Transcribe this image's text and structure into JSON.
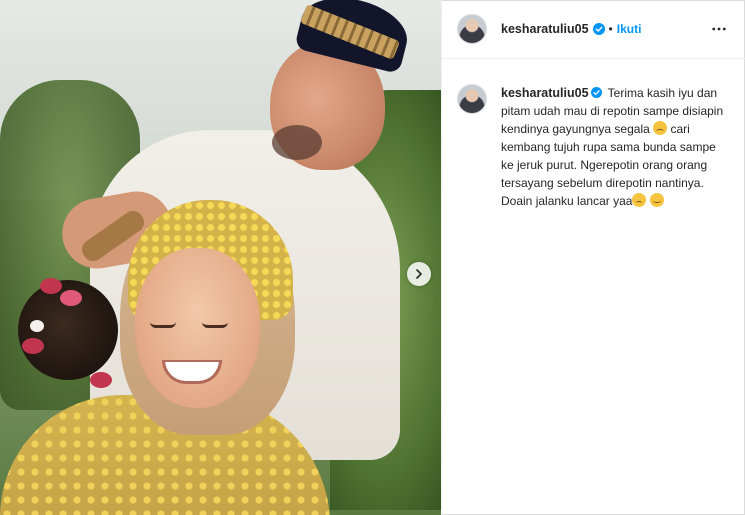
{
  "post": {
    "username": "kesharatuliu05",
    "separator": "•",
    "follow_label": "Ikuti",
    "caption_part1": "Terima kasih iyu dan pitam udah mau di repotin sampe disiapin kendinya gayungnya segala",
    "caption_part2": "cari kembang tujuh rupa sama bunda sampe ke jeruk purut. Ngerepotin orang orang tersayang sebelum direpotin nantinya. Doain jalanku lancar yaa",
    "emoji_1": "crying-face",
    "emoji_2": "sad-face",
    "emoji_3": "hugging-face"
  },
  "colors": {
    "follow": "#0095f6",
    "verified": "#0095f6",
    "text": "#262626",
    "border": "#dbdbdb"
  },
  "icons": {
    "verified": "verified-badge-icon",
    "more": "more-options-icon",
    "next": "chevron-right-icon"
  }
}
